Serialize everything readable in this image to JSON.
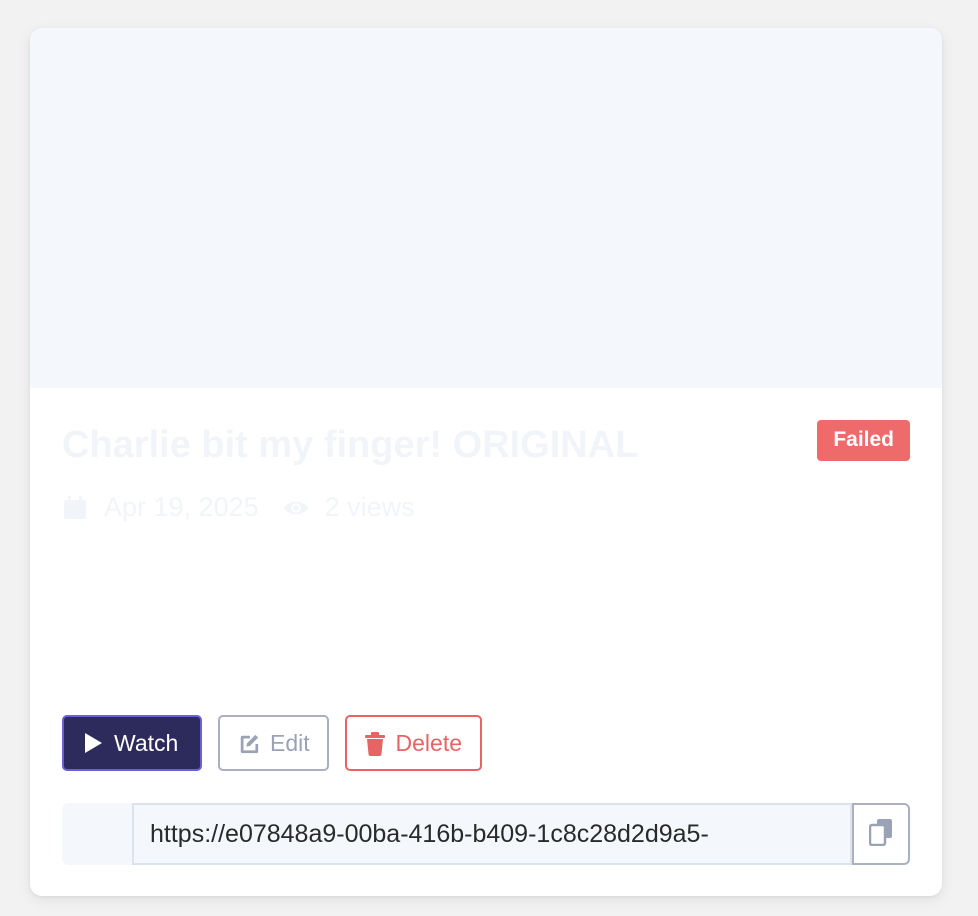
{
  "video": {
    "title": "Charlie bit my finger! ORIGINAL",
    "status": "Failed",
    "date": "Apr 19, 2025",
    "views": "2 views"
  },
  "actions": {
    "watch_label": "Watch",
    "edit_label": "Edit",
    "delete_label": "Delete"
  },
  "share": {
    "url": "https://e07848a9-00ba-416b-b409-1c8c28d2d9a5-"
  },
  "colors": {
    "status_failed": "#ef6b6b",
    "watch_bg": "#2d2b5c",
    "delete": "#e86464",
    "muted": "#9aa3b5"
  },
  "icons": {
    "watch": "play-icon",
    "edit": "edit-icon",
    "delete": "trash-icon",
    "date": "calendar-icon",
    "views": "eye-icon",
    "copy": "copy-icon"
  }
}
